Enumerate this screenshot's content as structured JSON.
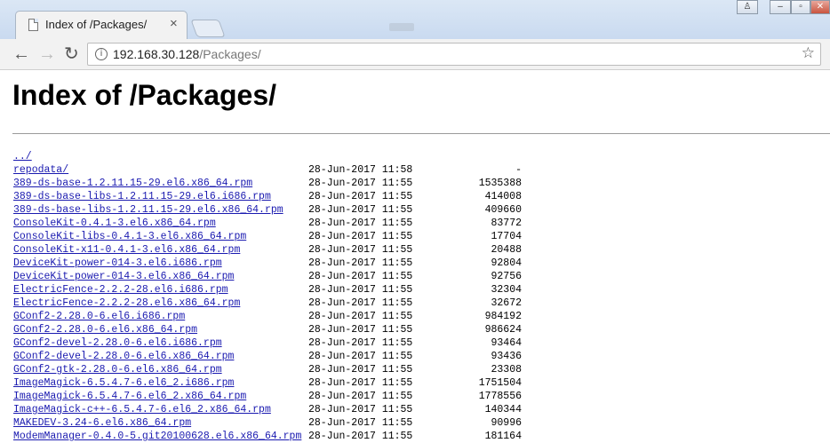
{
  "browser": {
    "tab_title": "Index of /Packages/",
    "tab_close": "×",
    "url_host": "192.168.30.128",
    "url_path": "/Packages/",
    "back_icon": "←",
    "forward_icon": "→",
    "reload_icon": "↻",
    "star_icon": "☆",
    "page_icon": "i",
    "user_icon": "♙",
    "minimize_icon": "–",
    "restore_icon": "▫",
    "close_icon": "✕"
  },
  "page": {
    "heading": "Index of /Packages/",
    "entries": [
      {
        "name": "../",
        "date": "",
        "size": ""
      },
      {
        "name": "repodata/",
        "date": "28-Jun-2017 11:58",
        "size": "-"
      },
      {
        "name": "389-ds-base-1.2.11.15-29.el6.x86_64.rpm",
        "date": "28-Jun-2017 11:55",
        "size": "1535388"
      },
      {
        "name": "389-ds-base-libs-1.2.11.15-29.el6.i686.rpm",
        "date": "28-Jun-2017 11:55",
        "size": "414008"
      },
      {
        "name": "389-ds-base-libs-1.2.11.15-29.el6.x86_64.rpm",
        "date": "28-Jun-2017 11:55",
        "size": "409660"
      },
      {
        "name": "ConsoleKit-0.4.1-3.el6.x86_64.rpm",
        "date": "28-Jun-2017 11:55",
        "size": "83772"
      },
      {
        "name": "ConsoleKit-libs-0.4.1-3.el6.x86_64.rpm",
        "date": "28-Jun-2017 11:55",
        "size": "17704"
      },
      {
        "name": "ConsoleKit-x11-0.4.1-3.el6.x86_64.rpm",
        "date": "28-Jun-2017 11:55",
        "size": "20488"
      },
      {
        "name": "DeviceKit-power-014-3.el6.i686.rpm",
        "date": "28-Jun-2017 11:55",
        "size": "92804"
      },
      {
        "name": "DeviceKit-power-014-3.el6.x86_64.rpm",
        "date": "28-Jun-2017 11:55",
        "size": "92756"
      },
      {
        "name": "ElectricFence-2.2.2-28.el6.i686.rpm",
        "date": "28-Jun-2017 11:55",
        "size": "32304"
      },
      {
        "name": "ElectricFence-2.2.2-28.el6.x86_64.rpm",
        "date": "28-Jun-2017 11:55",
        "size": "32672"
      },
      {
        "name": "GConf2-2.28.0-6.el6.i686.rpm",
        "date": "28-Jun-2017 11:55",
        "size": "984192"
      },
      {
        "name": "GConf2-2.28.0-6.el6.x86_64.rpm",
        "date": "28-Jun-2017 11:55",
        "size": "986624"
      },
      {
        "name": "GConf2-devel-2.28.0-6.el6.i686.rpm",
        "date": "28-Jun-2017 11:55",
        "size": "93464"
      },
      {
        "name": "GConf2-devel-2.28.0-6.el6.x86_64.rpm",
        "date": "28-Jun-2017 11:55",
        "size": "93436"
      },
      {
        "name": "GConf2-gtk-2.28.0-6.el6.x86_64.rpm",
        "date": "28-Jun-2017 11:55",
        "size": "23308"
      },
      {
        "name": "ImageMagick-6.5.4.7-6.el6_2.i686.rpm",
        "date": "28-Jun-2017 11:55",
        "size": "1751504"
      },
      {
        "name": "ImageMagick-6.5.4.7-6.el6_2.x86_64.rpm",
        "date": "28-Jun-2017 11:55",
        "size": "1778556"
      },
      {
        "name": "ImageMagick-c++-6.5.4.7-6.el6_2.x86_64.rpm",
        "date": "28-Jun-2017 11:55",
        "size": "140344"
      },
      {
        "name": "MAKEDEV-3.24-6.el6.x86_64.rpm",
        "date": "28-Jun-2017 11:55",
        "size": "90996"
      },
      {
        "name": "ModemManager-0.4.0-5.git20100628.el6.x86_64.rpm",
        "date": "28-Jun-2017 11:55",
        "size": "181164"
      }
    ]
  }
}
